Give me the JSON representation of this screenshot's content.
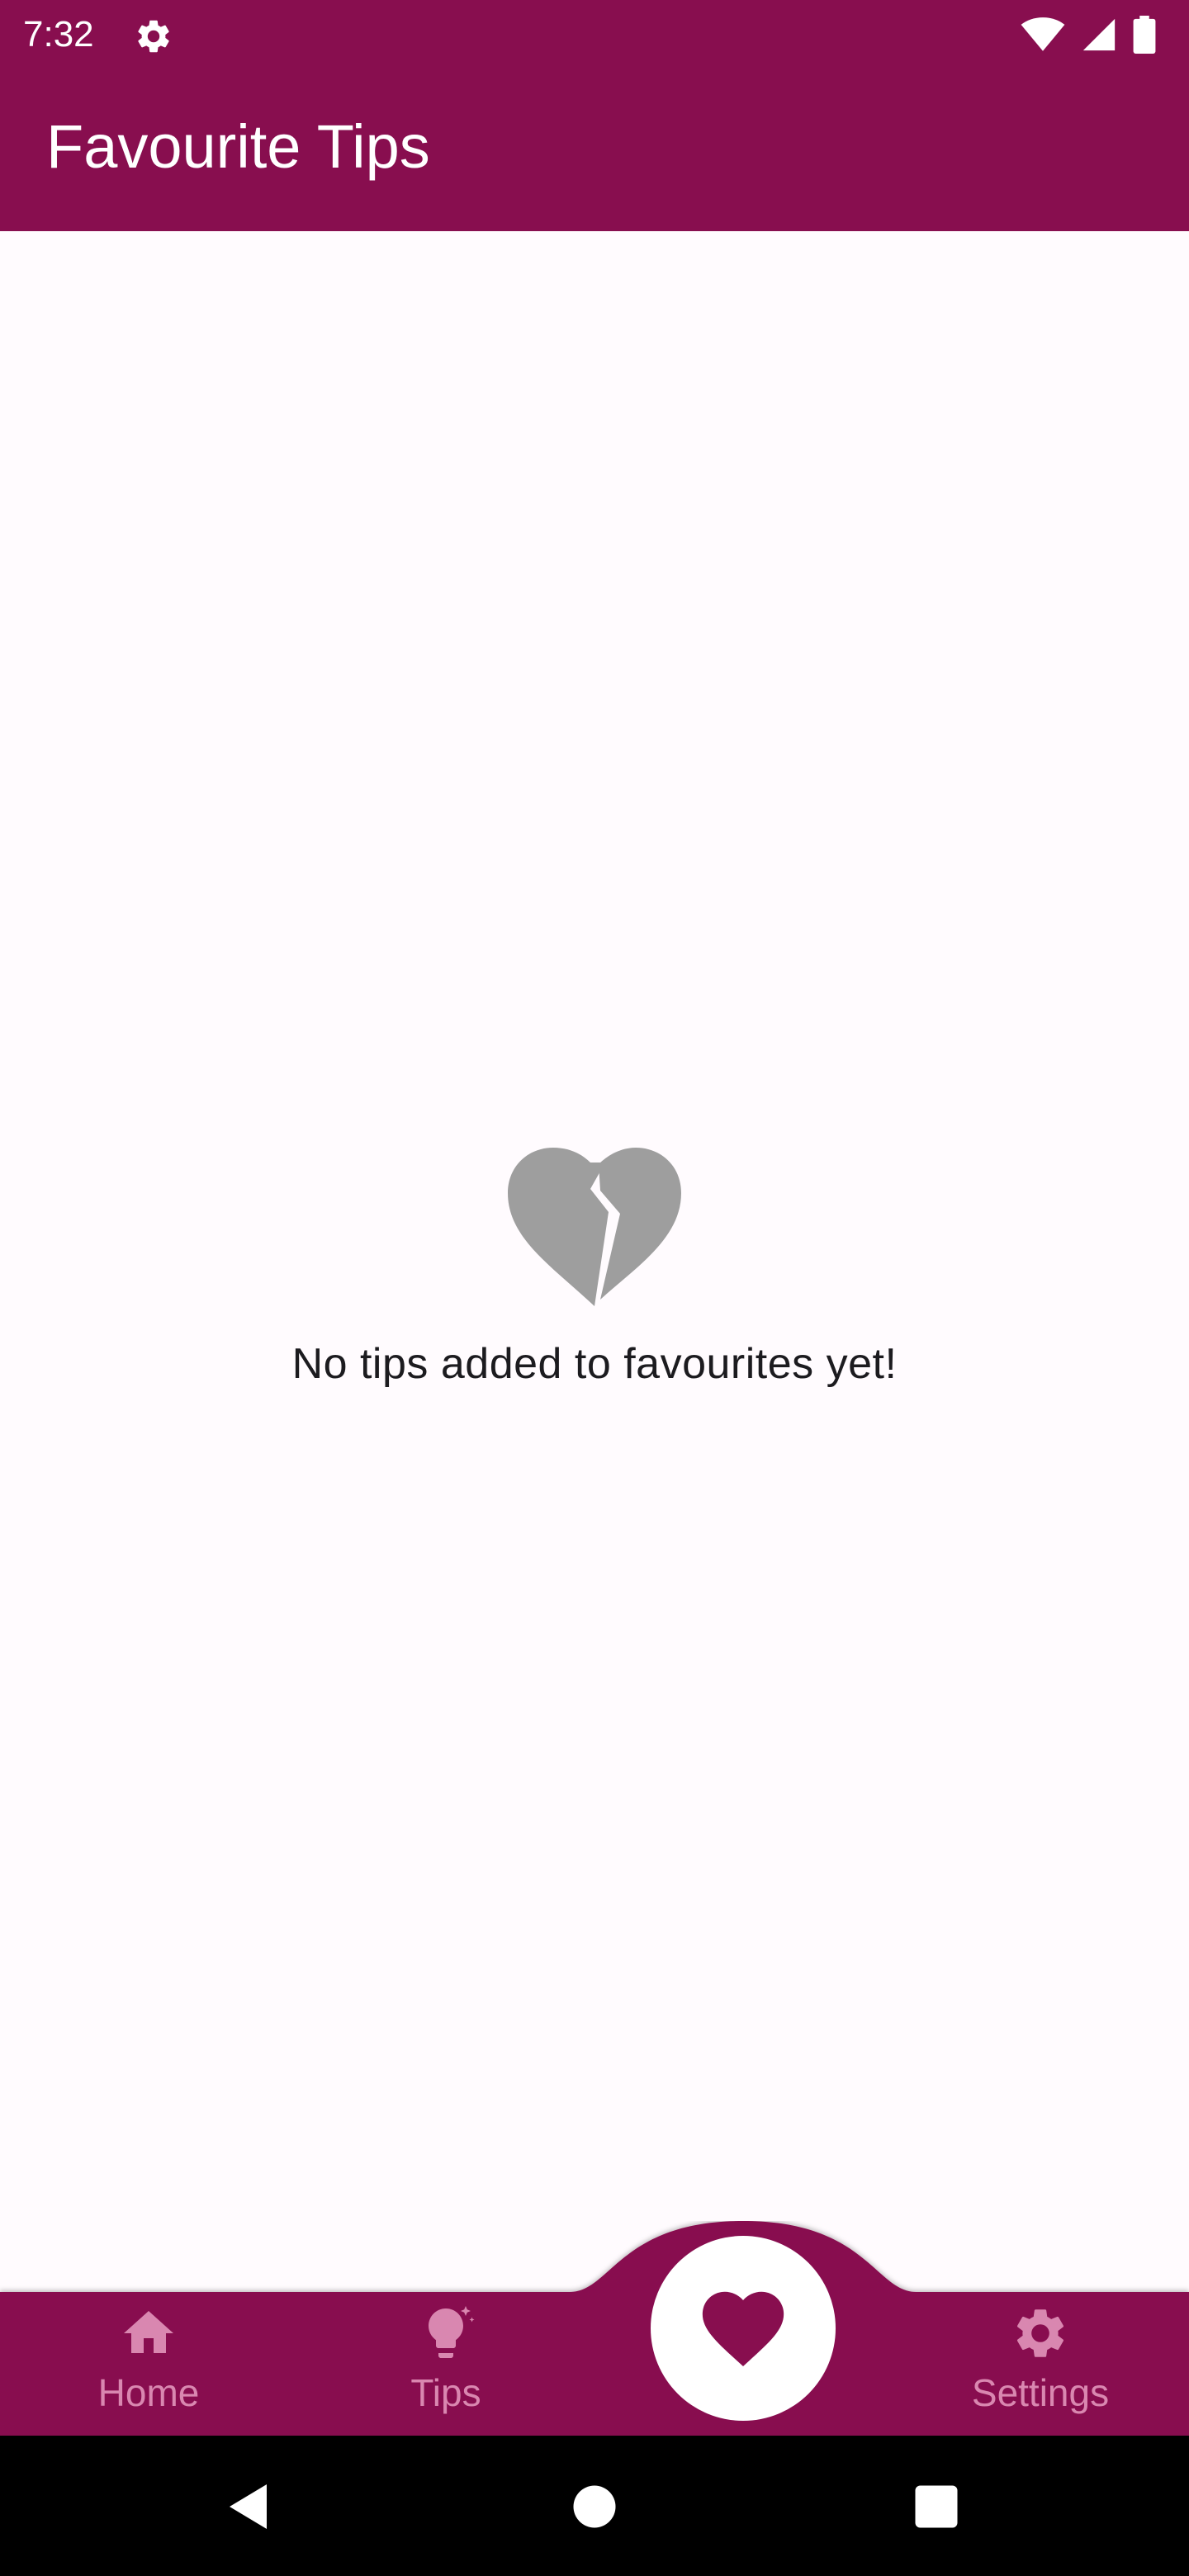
{
  "status_bar": {
    "time": "7:32",
    "icons": [
      "gear-icon",
      "wifi-icon",
      "signal-icon",
      "battery-icon"
    ]
  },
  "app_bar": {
    "title": "Favourite Tips"
  },
  "empty_state": {
    "icon": "broken-heart-icon",
    "message": "No tips added to favourites yet!"
  },
  "bottom_nav": {
    "items": [
      {
        "label": "Home",
        "icon": "home-icon"
      },
      {
        "label": "Tips",
        "icon": "lightbulb-icon"
      },
      {
        "label": "",
        "icon": "heart-icon",
        "selected": true
      },
      {
        "label": "Settings",
        "icon": "gear-icon"
      }
    ]
  },
  "system_nav": [
    "back-button",
    "home-button",
    "recents-button"
  ],
  "colors": {
    "primary": "#880E4F",
    "background": "#FFFBFE",
    "nav_inactive": "#D987B0",
    "empty_icon": "#9E9E9E",
    "text": "#1C1B1F"
  }
}
